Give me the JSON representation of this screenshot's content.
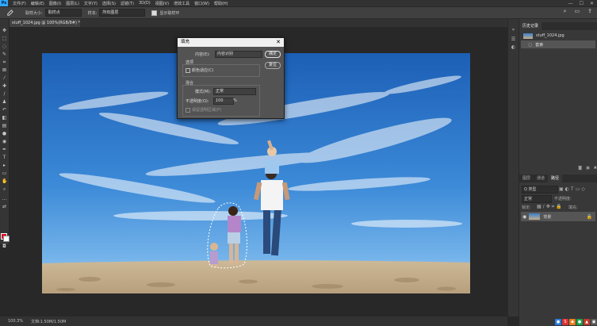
{
  "menubar": {
    "logo": "Ps",
    "items": [
      "文件(F)",
      "编辑(E)",
      "图像(I)",
      "图层(L)",
      "文字(Y)",
      "选择(S)",
      "滤镜(T)",
      "3D(D)",
      "视图(V)",
      "增效工具",
      "窗口(W)",
      "帮助(H)"
    ],
    "min": "—",
    "max": "☐",
    "close": "✕"
  },
  "options": {
    "size_label": "取样大小:",
    "size_value": "取样点",
    "sample_label": "样本:",
    "sample_value": "所有图层",
    "ring_label": "显示取样环"
  },
  "document": {
    "tab_label": "stuff_1024.jpg @ 100%(RGB/8#) *",
    "zoom": "100.3%",
    "doc_info": "文档:1.50M/1.50M"
  },
  "dialog": {
    "title": "填充",
    "close": "✕",
    "content_label": "内容(E):",
    "content_value": "内容识别",
    "ok": "确定",
    "cancel": "复位",
    "options_title": "选项",
    "color_adapt": "颜色适应(C)",
    "blend_title": "混合",
    "mode_label": "模式(M):",
    "mode_value": "正常",
    "opacity_label": "不透明度(O):",
    "opacity_value": "100",
    "opacity_unit": "%",
    "preserve": "保留透明区域(P)"
  },
  "history_panel": {
    "tabs": [
      "历史记录"
    ],
    "items": [
      "stuff_1024.jpg",
      "套索"
    ]
  },
  "layers_panel": {
    "tabs": [
      "图层",
      "通道",
      "路径"
    ],
    "kind_label": "Q 类型",
    "mode_value": "正常",
    "opacity_label": "不透明度:",
    "lock_label": "锁定:",
    "fill_label": "填充:",
    "layer_name": "背景"
  },
  "colors": {
    "accent": "#31a8ff",
    "foreground": "#e3001b",
    "background": "#ffffff"
  }
}
